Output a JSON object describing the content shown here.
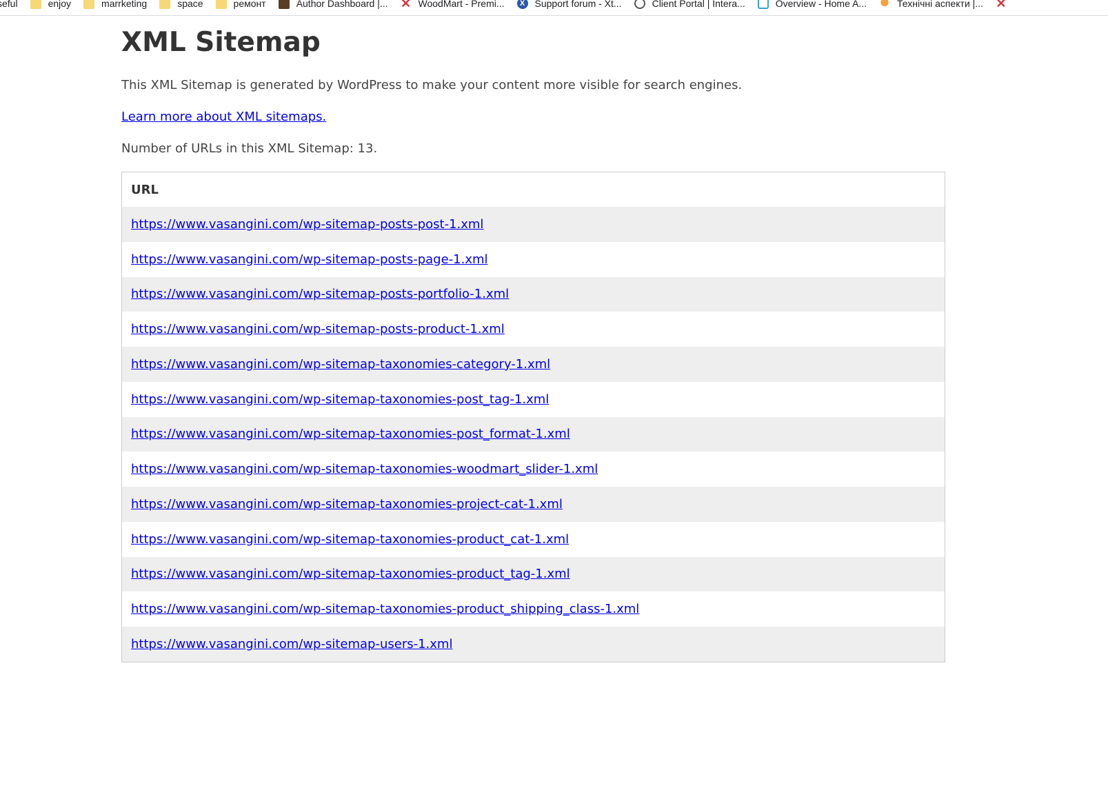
{
  "bookmarks": [
    {
      "label": "seful",
      "icon": "folder-icon"
    },
    {
      "label": "enjoy",
      "icon": "folder-icon"
    },
    {
      "label": "marrketing",
      "icon": "folder-icon"
    },
    {
      "label": "space",
      "icon": "folder-icon"
    },
    {
      "label": "ремонт",
      "icon": "folder-icon"
    },
    {
      "label": "Author Dashboard |...",
      "icon": "author-dashboard-icon"
    },
    {
      "label": "WoodMart - Premi...",
      "icon": "woodmart-icon"
    },
    {
      "label": "Support forum - Xt...",
      "icon": "support-forum-icon"
    },
    {
      "label": "Client Portal | Intera...",
      "icon": "client-portal-icon"
    },
    {
      "label": "Overview - Home A...",
      "icon": "overview-icon"
    },
    {
      "label": "Технічні аспекти |...",
      "icon": "lightbulb-icon"
    }
  ],
  "page": {
    "title": "XML Sitemap",
    "description": "This XML Sitemap is generated by WordPress to make your content more visible for search engines.",
    "learn_more": "Learn more about XML sitemaps.",
    "count_text": "Number of URLs in this XML Sitemap: 13."
  },
  "table": {
    "header": "URL",
    "urls": [
      "https://www.vasangini.com/wp-sitemap-posts-post-1.xml",
      "https://www.vasangini.com/wp-sitemap-posts-page-1.xml",
      "https://www.vasangini.com/wp-sitemap-posts-portfolio-1.xml",
      "https://www.vasangini.com/wp-sitemap-posts-product-1.xml",
      "https://www.vasangini.com/wp-sitemap-taxonomies-category-1.xml",
      "https://www.vasangini.com/wp-sitemap-taxonomies-post_tag-1.xml",
      "https://www.vasangini.com/wp-sitemap-taxonomies-post_format-1.xml",
      "https://www.vasangini.com/wp-sitemap-taxonomies-woodmart_slider-1.xml",
      "https://www.vasangini.com/wp-sitemap-taxonomies-project-cat-1.xml",
      "https://www.vasangini.com/wp-sitemap-taxonomies-product_cat-1.xml",
      "https://www.vasangini.com/wp-sitemap-taxonomies-product_tag-1.xml",
      "https://www.vasangini.com/wp-sitemap-taxonomies-product_shipping_class-1.xml",
      "https://www.vasangini.com/wp-sitemap-users-1.xml"
    ]
  },
  "colors": {
    "link": "#0000ee",
    "row_stripe": "#eeeeee",
    "table_border": "#cccccc",
    "text": "#444444"
  }
}
